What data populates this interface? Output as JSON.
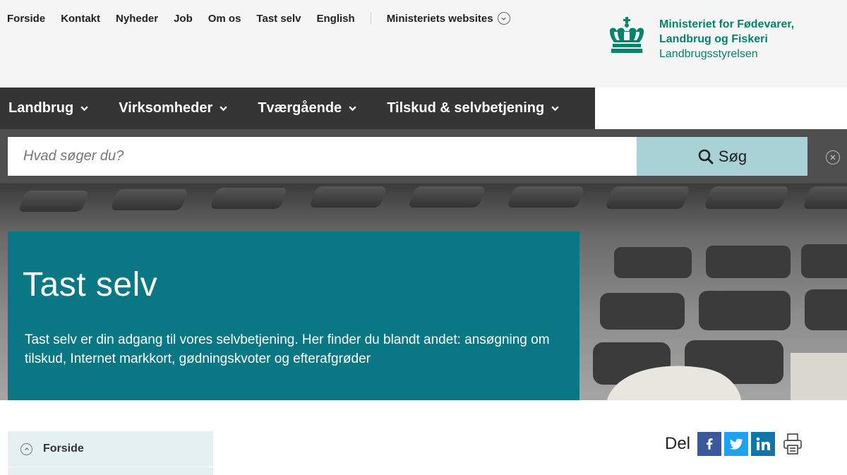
{
  "topnav": {
    "items": [
      "Forside",
      "Kontakt",
      "Nyheder",
      "Job",
      "Om os",
      "Tast selv",
      "English"
    ],
    "ministeries_label": "Ministeriets websites"
  },
  "logo": {
    "line1": "Ministeriet for Fødevarer,",
    "line2": "Landbrug og Fiskeri",
    "line3": "Landbrugsstyrelsen",
    "color": "#00836b"
  },
  "mainnav": {
    "items": [
      "Landbrug",
      "Virksomheder",
      "Tværgående",
      "Tilskud & selvbetjening"
    ]
  },
  "search": {
    "placeholder": "Hvad søger du?",
    "button_label": "Søg"
  },
  "hero": {
    "title": "Tast selv",
    "description": "Tast selv er din adgang til vores selvbetjening. Her finder du blandt andet: ansøgning om tilskud, Internet markkort, gødningskvoter og efterafgrøder",
    "card_color": "#0a7785"
  },
  "leftnav": {
    "item": "Forside"
  },
  "share": {
    "label": "Del",
    "icons": [
      "facebook-icon",
      "twitter-icon",
      "linkedin-icon",
      "print-icon"
    ]
  }
}
